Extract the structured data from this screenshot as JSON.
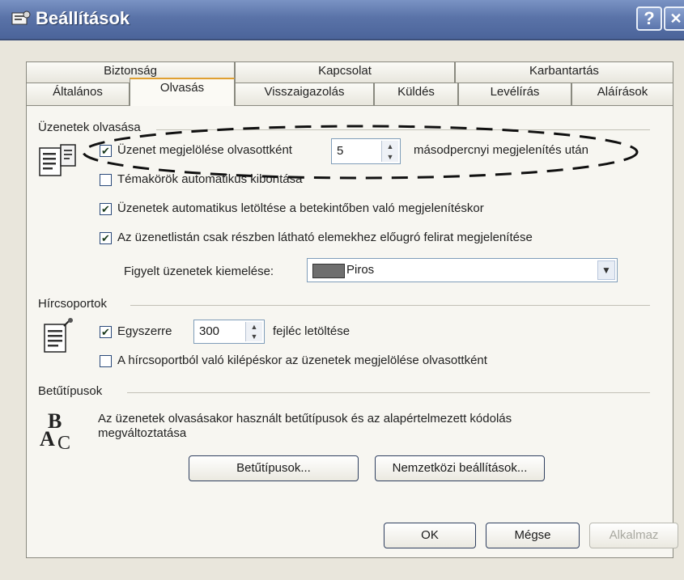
{
  "window": {
    "title": "Beállítások",
    "help_label": "?",
    "close_label": "✕"
  },
  "tabs": {
    "row_back": [
      {
        "label": "Biztonság"
      },
      {
        "label": "Kapcsolat"
      },
      {
        "label": "Karbantartás"
      }
    ],
    "row_front": [
      {
        "label": "Általános"
      },
      {
        "label": "Olvasás"
      },
      {
        "label": "Visszaigazolás"
      },
      {
        "label": "Küldés"
      },
      {
        "label": "Levélírás"
      },
      {
        "label": "Aláírások"
      }
    ],
    "active": "Olvasás"
  },
  "reading": {
    "section_title": "Üzenetek olvasása",
    "mark_read": {
      "checked": true,
      "label": "Üzenet megjelölése olvasottként",
      "seconds_value": "5",
      "suffix": "másodpercnyi megjelenítés után"
    },
    "auto_expand": {
      "checked": false,
      "label": "Témakörök automatikus kibontása"
    },
    "auto_download": {
      "checked": true,
      "label": "Üzenetek automatikus letöltése a betekintőben való megjelenítéskor"
    },
    "tooltips": {
      "checked": true,
      "label": "Az üzenetlistán csak részben látható elemekhez előugró felirat megjelenítése"
    },
    "highlight": {
      "label": "Figyelt üzenetek kiemelése:",
      "value": "Piros",
      "swatch_color": "#6e6e6e"
    }
  },
  "newsgroups": {
    "section_title": "Hírcsoportok",
    "get_headers": {
      "checked": true,
      "label": "Egyszerre",
      "value": "300",
      "suffix": "fejléc letöltése"
    },
    "mark_on_exit": {
      "checked": false,
      "label": "A hírcsoportból való kilépéskor az üzenetek megjelölése olvasottként"
    }
  },
  "fonts": {
    "section_title": "Betűtípusok",
    "description_line1": "Az üzenetek olvasásakor használt betűtípusok és az alapértelmezett kódolás",
    "description_line2": "megváltoztatása",
    "fonts_button": "Betűtípusok...",
    "intl_button": "Nemzetközi beállítások..."
  },
  "footer": {
    "ok": "OK",
    "cancel": "Mégse",
    "apply": "Alkalmaz"
  },
  "colors": {
    "titlebar": "#5a73a8",
    "active_tab_accent": "#e0a030",
    "annotation": "#111111"
  },
  "icons": {
    "title": "settings-window-icon",
    "reading": "document-reading-icon",
    "newsgroups": "newsgroup-document-icon",
    "fonts": "font-letters-icon"
  }
}
